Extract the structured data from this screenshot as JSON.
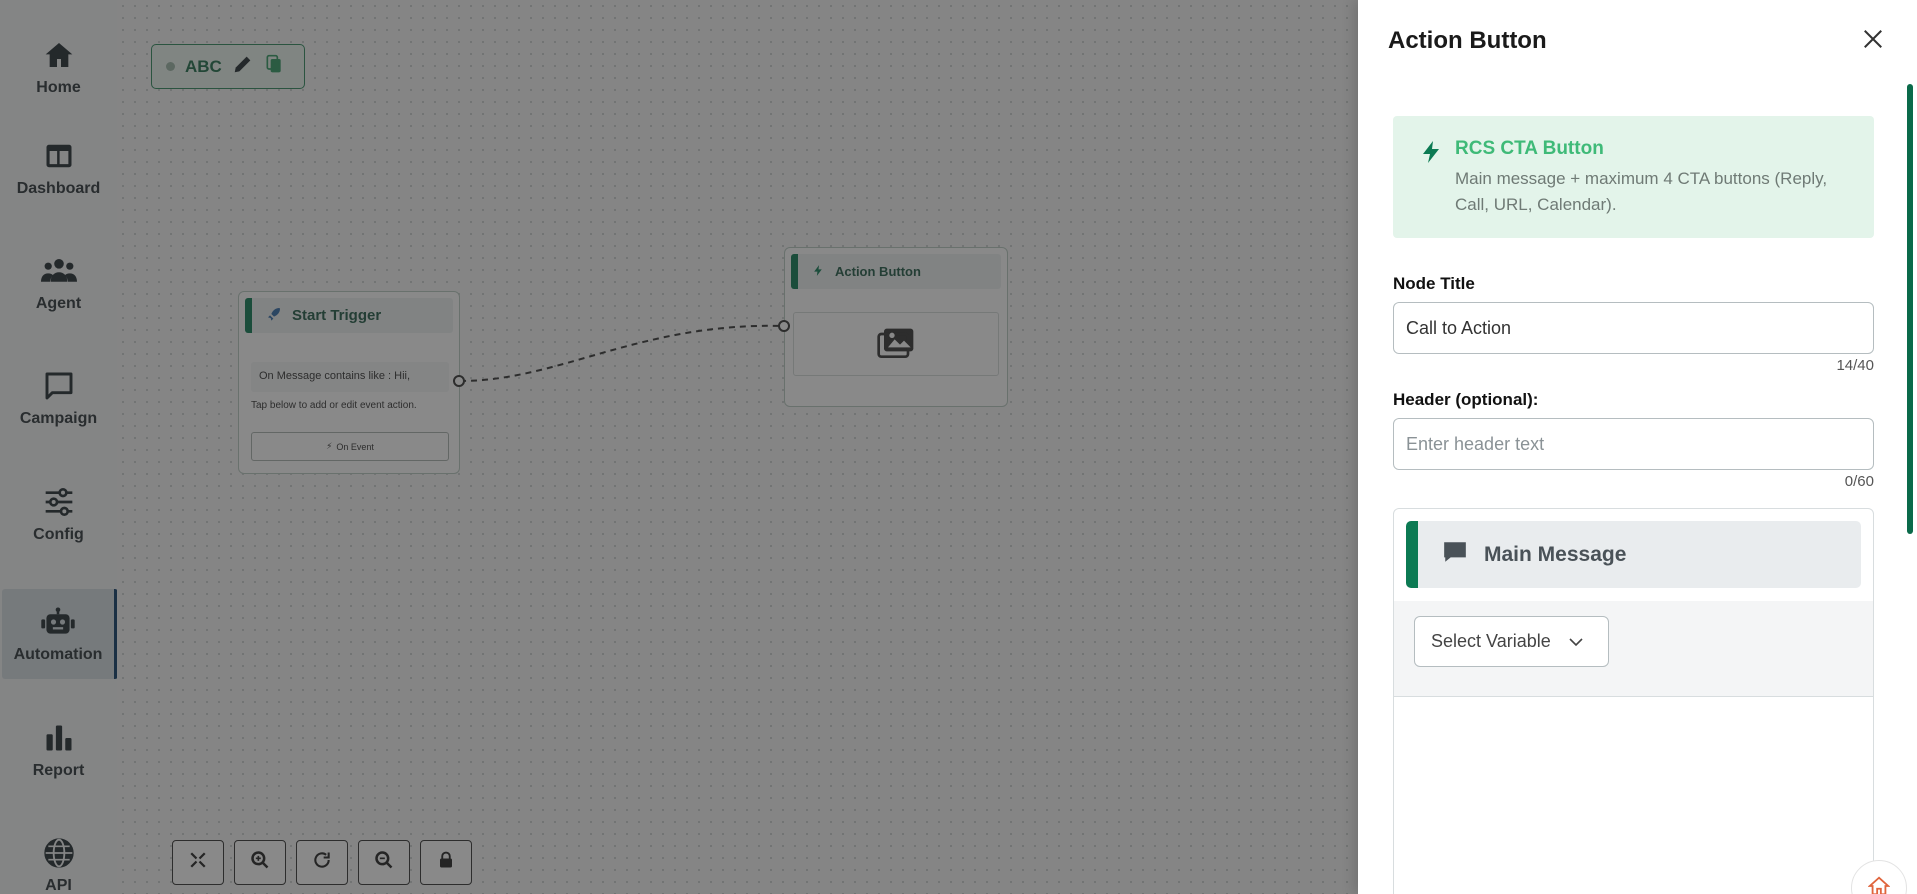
{
  "sidebar": {
    "items": [
      {
        "label": "Home",
        "icon": "home-icon"
      },
      {
        "label": "Dashboard",
        "icon": "dashboard-icon"
      },
      {
        "label": "Agent",
        "icon": "users-icon"
      },
      {
        "label": "Campaign",
        "icon": "chat-icon"
      },
      {
        "label": "Config",
        "icon": "sliders-icon"
      },
      {
        "label": "Automation",
        "icon": "robot-icon",
        "active": true
      },
      {
        "label": "Report",
        "icon": "bar-chart-icon"
      },
      {
        "label": "API",
        "icon": "globe-icon"
      }
    ]
  },
  "canvas": {
    "flow_name": "ABC",
    "start_node": {
      "title": "Start Trigger",
      "condition": "On Message contains like : Hii,",
      "hint": "Tap below to add or edit event action.",
      "event_button": "On Event"
    },
    "action_node": {
      "title": "Action Button"
    }
  },
  "drawer": {
    "title": "Action Button",
    "info": {
      "title": "RCS CTA Button",
      "description": "Main message + maximum 4 CTA buttons (Reply, Call, URL, Calendar)."
    },
    "node_title": {
      "label": "Node Title",
      "value": "Call to Action",
      "counter": "14/40"
    },
    "header": {
      "label": "Header (optional):",
      "placeholder": "Enter header text",
      "value": "",
      "counter": "0/60"
    },
    "main_message": {
      "title": "Main Message",
      "select_variable": "Select Variable"
    }
  },
  "colors": {
    "brand_green": "#0c7a53",
    "info_title_green": "#3fba78",
    "info_bg": "#e3f4ea",
    "active_nav_border": "#0d3b66"
  }
}
